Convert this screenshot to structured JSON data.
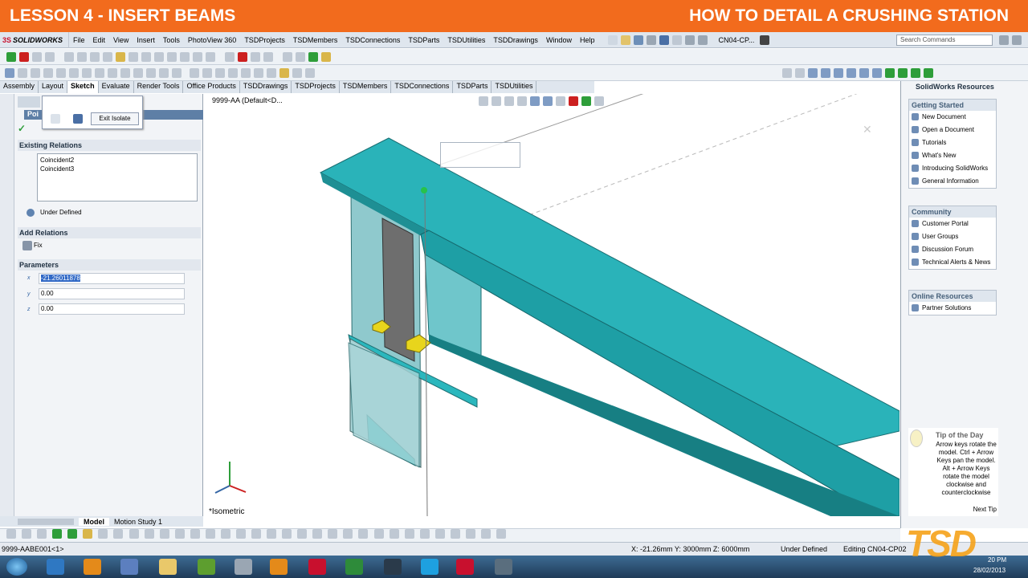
{
  "banner": {
    "left": "LESSON 4 - INSERT BEAMS",
    "right": "HOW TO DETAIL A CRUSHING STATION"
  },
  "app": {
    "name": "SOLIDWORKS"
  },
  "menu": [
    "File",
    "Edit",
    "View",
    "Insert",
    "Tools",
    "PhotoView 360",
    "TSDProjects",
    "TSDMembers",
    "TSDConnections",
    "TSDParts",
    "TSDUtilities",
    "TSDDrawings",
    "Window",
    "Help"
  ],
  "doc_short": "CN04-CP...",
  "search_placeholder": "Search Commands",
  "cm_tabs": [
    "Assembly",
    "Layout",
    "Sketch",
    "Evaluate",
    "Render Tools",
    "Office Products",
    "TSDDrawings",
    "TSDProjects",
    "TSDMembers",
    "TSDConnections",
    "TSDParts",
    "TSDUtilities"
  ],
  "cm_active": "Sketch",
  "pm": {
    "title": "Poi",
    "exit_isolate": "Exit Isolate",
    "existing_relations": "Existing Relations",
    "relations": [
      "Coincident2",
      "Coincident3"
    ],
    "under_defined": "Under Defined",
    "add_relations": "Add Relations",
    "fix": "Fix",
    "parameters": "Parameters",
    "x_label": "x",
    "y_label": "y",
    "z_label": "z",
    "x": "-21.26011878",
    "y": "0.00",
    "z": "0.00"
  },
  "viewport": {
    "tree": "9999-AA  (Default<D...",
    "view_name": "*Isometric"
  },
  "rp": {
    "title": "SolidWorks Resources",
    "getting_started": {
      "header": "Getting Started",
      "items": [
        "New Document",
        "Open a Document",
        "Tutorials",
        "What's New",
        "Introducing SolidWorks",
        "General Information"
      ]
    },
    "community": {
      "header": "Community",
      "items": [
        "Customer Portal",
        "User Groups",
        "Discussion Forum",
        "Technical Alerts & News"
      ]
    },
    "online": {
      "header": "Online Resources",
      "items": [
        "Partner Solutions"
      ]
    },
    "tip": {
      "title": "Tip of the Day",
      "text": "Arrow keys rotate the model. Ctrl + Arrow Keys pan the model. Alt + Arrow Keys rotate the model clockwise and counterclockwise",
      "next": "Next Tip"
    }
  },
  "bottom_tabs": [
    "Model",
    "Motion Study 1"
  ],
  "status": {
    "left": "9999-AABE001<1>",
    "coords": "X: -21.26mm Y: 3000mm Z: 6000mm",
    "state": "Under Defined",
    "editing": "Editing CN04-CP02"
  },
  "tray": {
    "time": "20 PM",
    "date": "28/02/2013"
  },
  "watermark": "TSD",
  "colors": {
    "banner": "#f26b1d",
    "beam": "#2bb7bd",
    "plate": "#93c7cc",
    "bolt": "#e8d51c"
  }
}
